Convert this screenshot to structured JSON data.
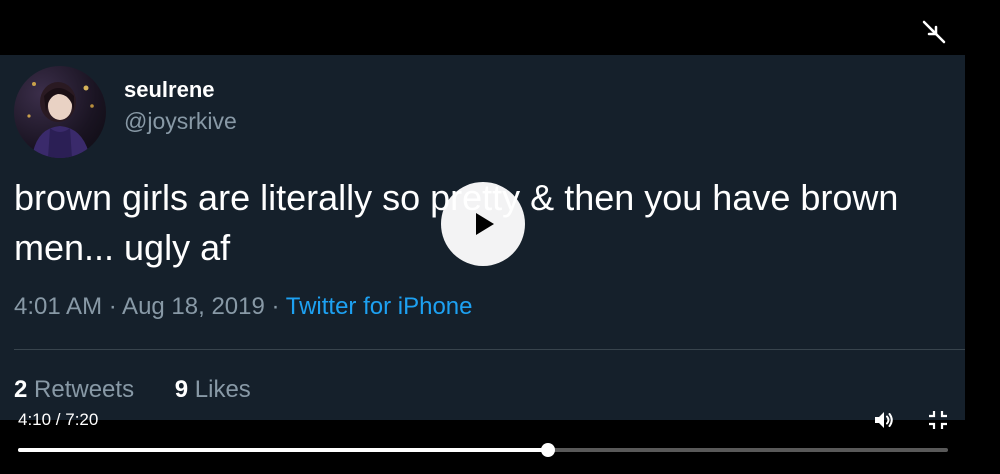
{
  "tweet": {
    "display_name": "seulrene",
    "handle": "@joysrkive",
    "text": "brown girls are literally so pretty & then you have brown men... ugly af",
    "timestamp": "4:01 AM · Aug 18, 2019 · ",
    "source": "Twitter for iPhone",
    "retweets_count": "2",
    "retweets_label": " Retweets",
    "likes_count": "9",
    "likes_label": " Likes"
  },
  "player": {
    "time": "4:10 / 7:20",
    "progress": 0.57,
    "play_icon": "play-icon",
    "volume_icon": "volume-icon",
    "exit_fullscreen_icon": "exit-fullscreen-icon"
  },
  "colors": {
    "tweet_background": "#15202b",
    "link": "#1da1f2",
    "secondary_text": "#8899a6"
  }
}
